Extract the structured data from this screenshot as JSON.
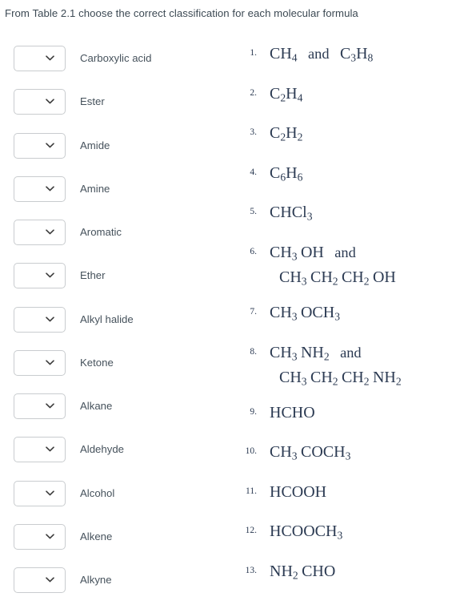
{
  "prompt": "From Table 2.1 choose the correct classification for each molecular formula",
  "classifications": [
    {
      "label": "Carboxylic acid",
      "value": ""
    },
    {
      "label": "Ester",
      "value": ""
    },
    {
      "label": "Amide",
      "value": ""
    },
    {
      "label": "Amine",
      "value": ""
    },
    {
      "label": "Aromatic",
      "value": ""
    },
    {
      "label": "Ether",
      "value": ""
    },
    {
      "label": "Alkyl halide",
      "value": ""
    },
    {
      "label": "Ketone",
      "value": ""
    },
    {
      "label": "Alkane",
      "value": ""
    },
    {
      "label": "Aldehyde",
      "value": ""
    },
    {
      "label": "Alcohol",
      "value": ""
    },
    {
      "label": "Alkene",
      "value": ""
    },
    {
      "label": "Alkyne",
      "value": ""
    }
  ],
  "dropdown_icon": "chevron-down-icon",
  "formulas": [
    {
      "number": "1.",
      "text": "CH4 and C3H8",
      "line1": "CH4 and C3H8",
      "line2": ""
    },
    {
      "number": "2.",
      "text": "C2H4",
      "line1": "C2H4",
      "line2": ""
    },
    {
      "number": "3.",
      "text": "C2H2",
      "line1": "C2H2",
      "line2": ""
    },
    {
      "number": "4.",
      "text": "C6H6",
      "line1": "C6H6",
      "line2": ""
    },
    {
      "number": "5.",
      "text": "CHCl3",
      "line1": "CHCl3",
      "line2": ""
    },
    {
      "number": "6.",
      "text": "CH3 OH and CH3 CH2 CH2 OH",
      "line1": "CH3 OH and",
      "line2": "CH3 CH2 CH2 OH"
    },
    {
      "number": "7.",
      "text": "CH3 OCH3",
      "line1": "CH3 OCH3",
      "line2": ""
    },
    {
      "number": "8.",
      "text": "CH3 NH2 and CH3 CH2 CH2 NH2",
      "line1": "CH3 NH2 and",
      "line2": "CH3 CH2 CH2 NH2"
    },
    {
      "number": "9.",
      "text": "HCHO",
      "line1": "HCHO",
      "line2": ""
    },
    {
      "number": "10.",
      "text": "CH3 COCH3",
      "line1": "CH3 COCH3",
      "line2": ""
    },
    {
      "number": "11.",
      "text": "HCOOH",
      "line1": "HCOOH",
      "line2": ""
    },
    {
      "number": "12.",
      "text": "HCOOCH3",
      "line1": "HCOOCH3",
      "line2": ""
    },
    {
      "number": "13.",
      "text": "NH2 CHO",
      "line1": "NH2 CHO",
      "line2": ""
    }
  ],
  "colors": {
    "prompt_text": "#3d4a54",
    "label_text": "#46525c",
    "formula_text": "#2b3a52",
    "select_border": "#c9cccf",
    "background": "#ffffff"
  }
}
